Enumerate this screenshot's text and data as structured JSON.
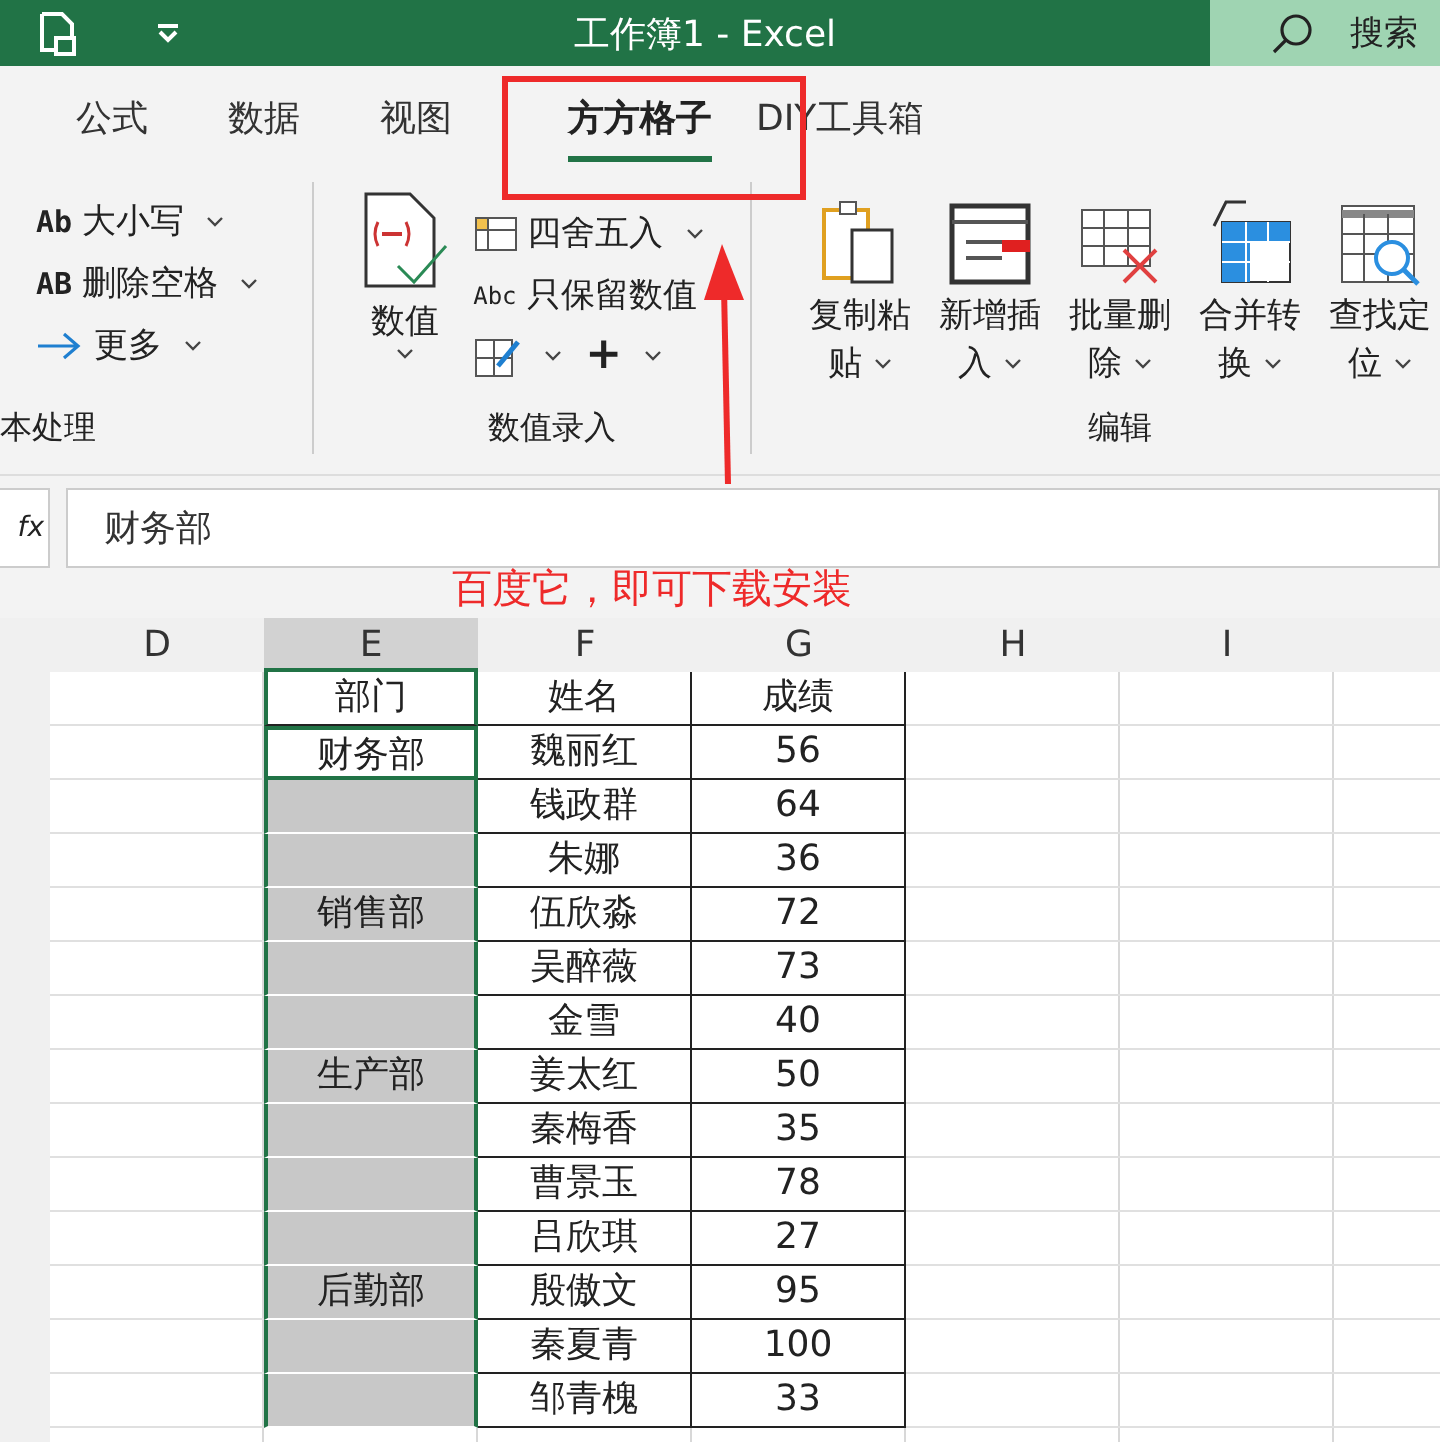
{
  "title_bar": {
    "title": "工作簿1  -  Excel",
    "search": "搜索"
  },
  "tabs": [
    {
      "label": "公式",
      "selected": false
    },
    {
      "label": "数据",
      "selected": false
    },
    {
      "label": "视图",
      "selected": false
    },
    {
      "label": "方方格子",
      "selected": true
    },
    {
      "label": "DIY工具箱",
      "selected": false
    }
  ],
  "ribbon": {
    "text_group": {
      "label": "本处理",
      "items": [
        {
          "glyph": "Ab",
          "label": "大小写",
          "dropdown": true
        },
        {
          "glyph": "AB",
          "label": "删除空格",
          "dropdown": true
        },
        {
          "label": "更多",
          "dropdown": true
        }
      ]
    },
    "number_group": {
      "label": "数值录入",
      "big": {
        "label": "数值",
        "dropdown": true
      },
      "items": [
        {
          "label": "四舍五入",
          "dropdown": true
        },
        {
          "glyph": "Abc",
          "label": "只保留数值",
          "dropdown": false
        }
      ],
      "tools": [
        {
          "dropdown": true
        },
        {
          "label": "+",
          "dropdown": true
        }
      ]
    },
    "edit_group": {
      "label": "编辑",
      "buttons": [
        {
          "lines": [
            "复制粘",
            "贴"
          ]
        },
        {
          "lines": [
            "新增插",
            "入"
          ]
        },
        {
          "lines": [
            "批量删",
            "除"
          ]
        },
        {
          "lines": [
            "合并转",
            "换"
          ]
        },
        {
          "lines": [
            "查找定",
            "位"
          ]
        }
      ]
    }
  },
  "formula_bar": {
    "function_label": "fx",
    "value": "财务部"
  },
  "sheet": {
    "columns": [
      {
        "label": "D",
        "selected": false
      },
      {
        "label": "E",
        "selected": true
      },
      {
        "label": "F",
        "selected": false
      },
      {
        "label": "G",
        "selected": false
      },
      {
        "label": "H",
        "selected": false
      },
      {
        "label": "I",
        "selected": false
      }
    ],
    "rows": [
      {
        "dept": "部门",
        "name": "姓名",
        "score": "成绩",
        "shaded": false,
        "active": false
      },
      {
        "dept": "财务部",
        "name": "魏丽红",
        "score": "56",
        "shaded": false,
        "active": true
      },
      {
        "name": "钱政群",
        "score": "64",
        "shaded": true,
        "active": false
      },
      {
        "name": "朱娜",
        "score": "36",
        "shaded": true,
        "active": false
      },
      {
        "dept": "销售部",
        "name": "伍欣淼",
        "score": "72",
        "shaded": true,
        "active": false
      },
      {
        "name": "吴醉薇",
        "score": "73",
        "shaded": true,
        "active": false
      },
      {
        "name": "金雪",
        "score": "40",
        "shaded": true,
        "active": false
      },
      {
        "dept": "生产部",
        "name": "姜太红",
        "score": "50",
        "shaded": true,
        "active": false
      },
      {
        "name": "秦梅香",
        "score": "35",
        "shaded": true,
        "active": false
      },
      {
        "name": "曹景玉",
        "score": "78",
        "shaded": true,
        "active": false
      },
      {
        "name": "吕欣琪",
        "score": "27",
        "shaded": true,
        "active": false
      },
      {
        "dept": "后勤部",
        "name": "殷傲文",
        "score": "95",
        "shaded": true,
        "active": false
      },
      {
        "name": "秦夏青",
        "score": "100",
        "shaded": true,
        "active": false
      },
      {
        "name": "邹青槐",
        "score": "33",
        "shaded": true,
        "active": false
      }
    ]
  },
  "annotation": {
    "note": "百度它，即可下载安装"
  }
}
